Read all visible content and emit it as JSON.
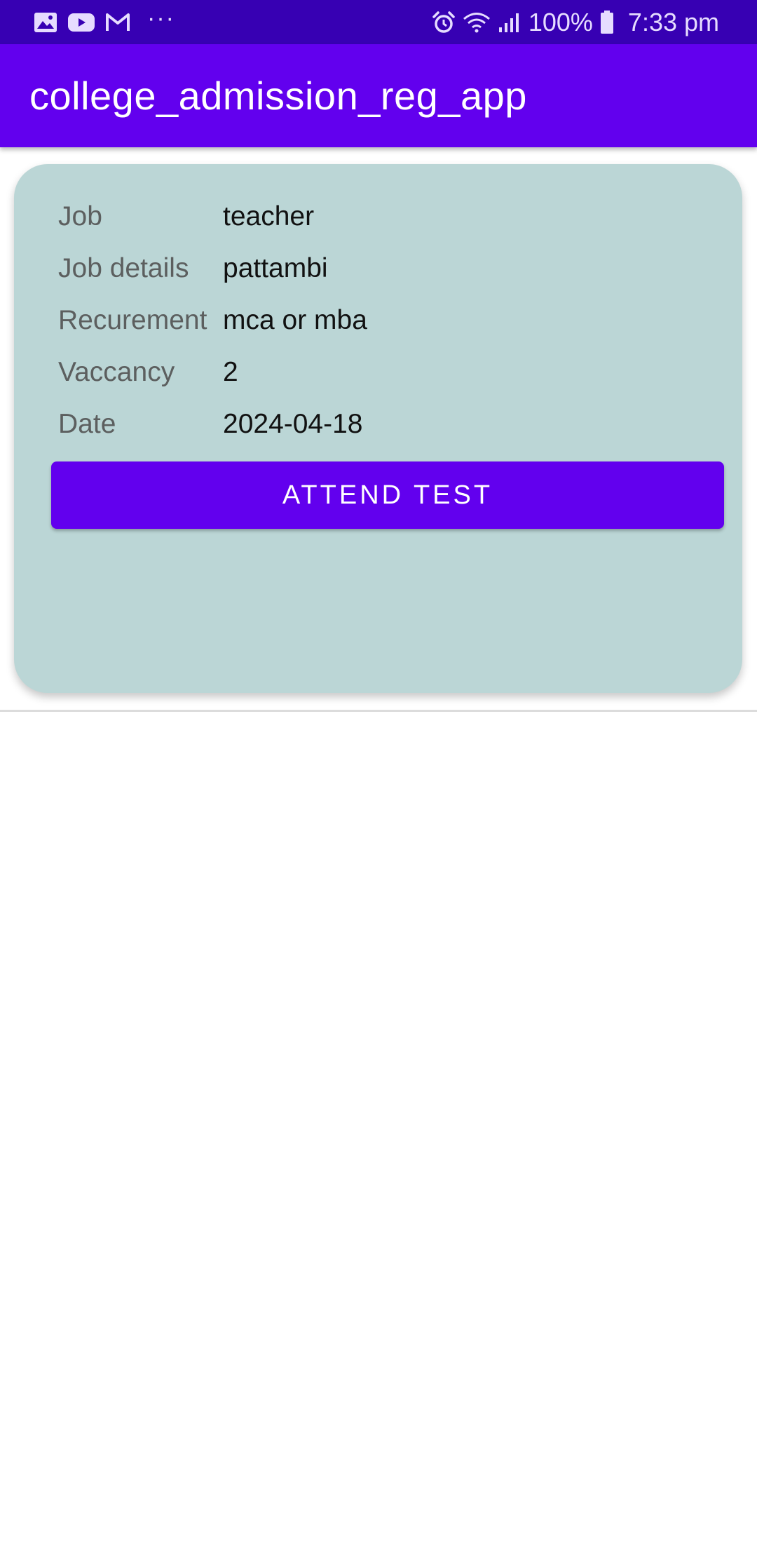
{
  "status_bar": {
    "notification_icons": [
      "gallery-icon",
      "youtube-icon",
      "gmail-icon"
    ],
    "more_indicator": "···",
    "battery_percent": "100%",
    "time": "7:33 pm"
  },
  "app_bar": {
    "title": "college_admission_reg_app"
  },
  "job_card": {
    "rows": [
      {
        "label": "Job",
        "value": "teacher"
      },
      {
        "label": "Job details",
        "value": "pattambi"
      },
      {
        "label": "Recurement",
        "value": "mca or mba"
      },
      {
        "label": "Vaccancy",
        "value": "2"
      },
      {
        "label": "Date",
        "value": "2024-04-18"
      }
    ],
    "button_label": "ATTEND TEST"
  },
  "colors": {
    "status_bar": "#3700b3",
    "primary": "#6200ee",
    "card_background": "#bbd6d6",
    "label_text": "#5c5f5f",
    "value_text": "#111111"
  }
}
